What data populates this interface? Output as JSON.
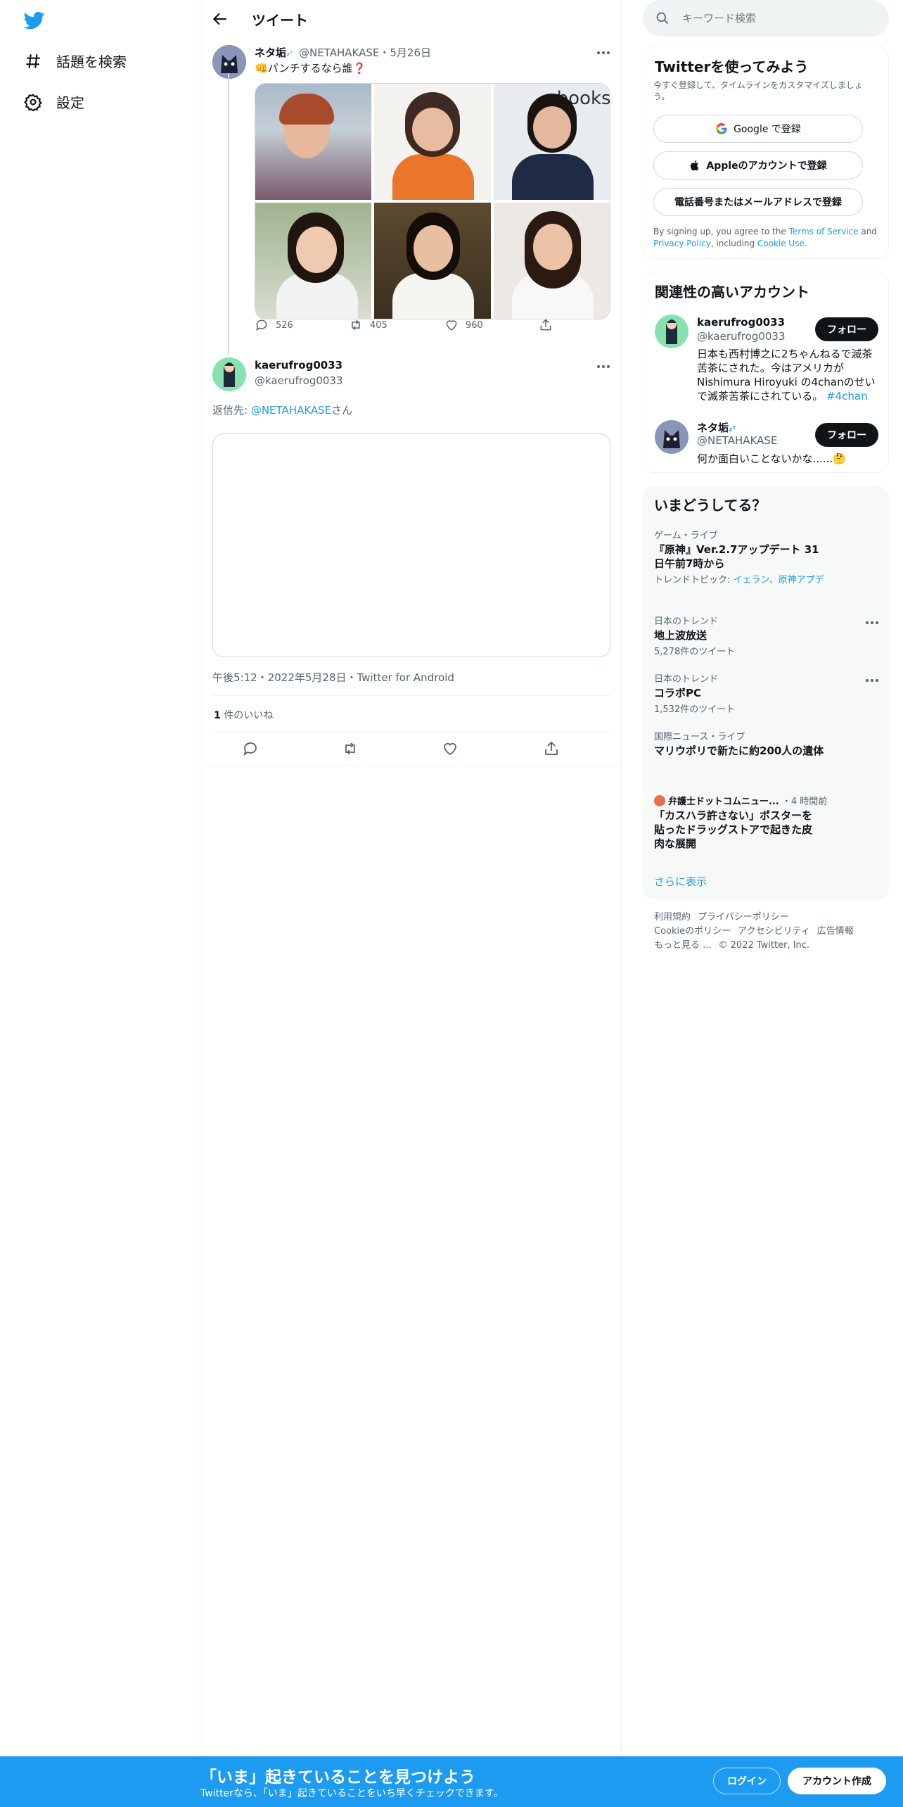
{
  "nav": {
    "items": [
      {
        "label": "話題を検索",
        "icon": "hashtag-icon"
      },
      {
        "label": "設定",
        "icon": "gear-icon"
      }
    ]
  },
  "header": {
    "title": "ツイート"
  },
  "quoted_tweet": {
    "name": "ネタ垢",
    "sleep": "₂ᶻ",
    "handle": "@NETAHAKASE",
    "date": "・5月26日",
    "emoji": "👊",
    "text": "パンチするなら誰",
    "question": "❓",
    "counts": {
      "reply": "526",
      "retweet": "405",
      "like": "960"
    }
  },
  "tweet": {
    "name": "kaerufrog0033",
    "handle": "@kaerufrog0033",
    "reply_prefix": "返信先: ",
    "reply_mention": "@NETAHAKASE",
    "reply_suffix": "さん",
    "meta": "午後5:12・2022年5月28日・Twitter for Android",
    "likes_count": "1",
    "likes_label": " 件のいいね"
  },
  "search": {
    "placeholder": "キーワード検索"
  },
  "signup_card": {
    "title": "Twitterを使ってみよう",
    "subtitle": "今すぐ登録して、タイムラインをカスタマイズしましょう。",
    "google": "Google で登録",
    "apple": "Appleのアカウントで登録",
    "phone": "電話番号またはメールアドレスで登録",
    "legal_a": "By signing up, you agree to the ",
    "tos": "Terms of Service",
    "legal_b": " and ",
    "privacy": "Privacy Policy",
    "legal_c": ", including ",
    "cookie": "Cookie Use",
    "legal_d": "."
  },
  "related": {
    "title": "関連性の高いアカウント",
    "accounts": [
      {
        "name": "kaerufrog0033",
        "handle": "@kaerufrog0033",
        "bio": "日本も西村博之に2ちゃんねるで滅茶苦茶にされた。今はアメリカがNishimura Hiroyuki の4chanのせいで滅茶苦茶にされている。",
        "tag": "#4chan",
        "follow": "フォロー"
      },
      {
        "name": "ネタ垢",
        "sleep": "₂ᶻ",
        "handle": "@NETAHAKASE",
        "bio": "何か面白いことないかな......",
        "emoji": "🤔",
        "follow": "フォロー"
      }
    ]
  },
  "trends": {
    "title": "いまどうしてる？",
    "items": [
      {
        "category": "ゲーム・ライブ",
        "name": "『原神』Ver.2.7アップデート 31日午前7時から",
        "topic_prefix": "トレンドトピック: ",
        "topic": "イェラン、原神アプデ"
      },
      {
        "category": "日本のトレンド",
        "name": "地上波放送",
        "count": "5,278件のツイート"
      },
      {
        "category": "日本のトレンド",
        "name": "コラボPC",
        "count": "1,532件のツイート"
      },
      {
        "category": "国際ニュース・ライブ",
        "name": "マリウポリで新たに約200人の遺体"
      },
      {
        "source": "弁護士ドットコムニュー...",
        "time": "・4 時間前",
        "name": "「カスハラ許さない」ポスターを貼ったドラッグストアで起きた皮肉な展開"
      }
    ],
    "more": "さらに表示"
  },
  "footer": {
    "links": [
      "利用規約",
      "プライバシーポリシー",
      "Cookieのポリシー",
      "アクセシビリティ",
      "広告情報",
      "もっと見る ..."
    ],
    "copyright": "© 2022 Twitter, Inc."
  },
  "bottom_bar": {
    "title": "「いま」起きていることを見つけよう",
    "subtitle": "Twitterなら、「いま」起きていることをいち早くチェックできます。",
    "login": "ログイン",
    "signup": "アカウント作成"
  },
  "colors": {
    "accent": "#1d9bf0",
    "text": "#0f1419",
    "muted": "#536471",
    "border": "#eff3f4"
  }
}
